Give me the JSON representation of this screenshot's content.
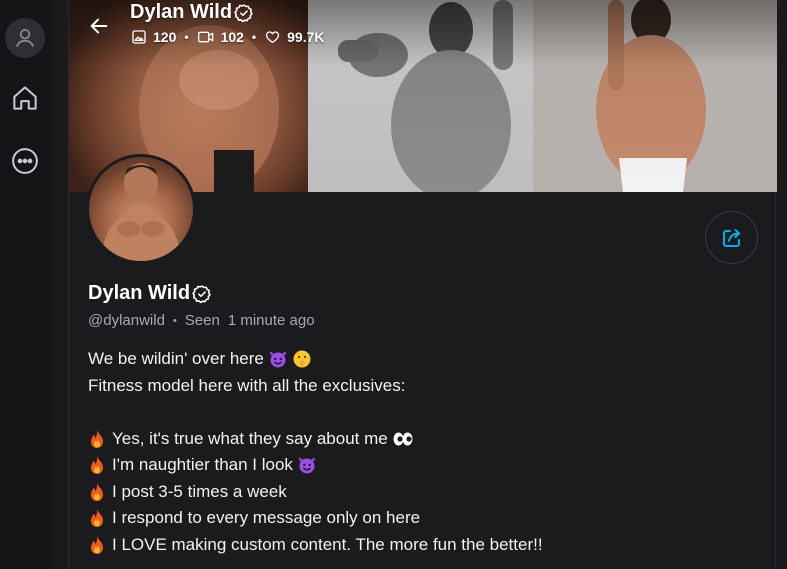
{
  "profile": {
    "name": "Dylan Wild",
    "handle": "@dylanwild",
    "seen_label": "Seen",
    "seen_time": "1 minute ago"
  },
  "stats": {
    "photos": "120",
    "videos": "102",
    "likes": "99.7K"
  },
  "bio": {
    "line1": "We be wildin' over here",
    "line2": "Fitness model here with all the exclusives:",
    "bullet1": "Yes, it's true what they say about me",
    "bullet2": "I'm naughtier than I look",
    "bullet3": "I post 3-5 times a week",
    "bullet4": "I respond to every message only on here",
    "bullet5": "I LOVE making custom content. The more fun the better!!"
  },
  "colors": {
    "background": "#1a1a1c",
    "text_primary": "#ffffff",
    "text_secondary": "#a8a8b0",
    "accent": "#00aff0"
  },
  "icons": {
    "rail": [
      "user-icon",
      "home-icon",
      "more-icon"
    ],
    "cover": [
      "back-arrow-icon",
      "verified-icon",
      "image-icon",
      "video-icon",
      "heart-icon"
    ],
    "actions": [
      "share-icon"
    ]
  }
}
